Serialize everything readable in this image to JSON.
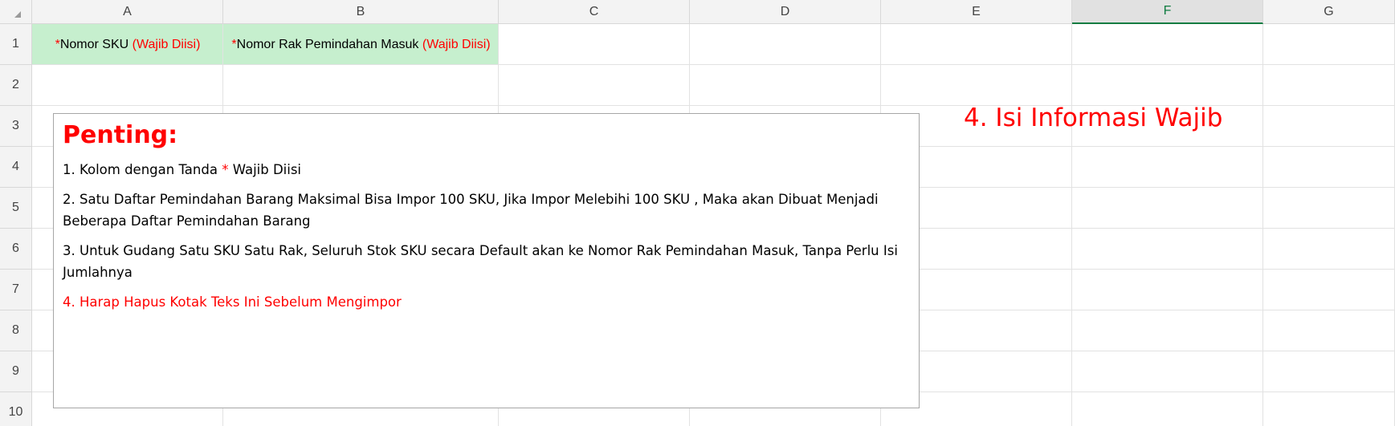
{
  "sheet": {
    "columns": [
      "A",
      "B",
      "C",
      "D",
      "E",
      "F",
      "G"
    ],
    "selected_column": "F",
    "rows": [
      "1",
      "2",
      "3",
      "4",
      "5",
      "6",
      "7",
      "8",
      "9",
      "10"
    ]
  },
  "cells": {
    "A1": {
      "mark": "*",
      "label": "Nomor SKU",
      "suffix": "(Wajib Diisi)"
    },
    "B1": {
      "mark": "*",
      "label": "Nomor Rak Pemindahan Masuk",
      "suffix": "(Wajib Diisi)"
    }
  },
  "textbox": {
    "title": "Penting:",
    "line1_prefix": "1. Kolom dengan Tanda",
    "line1_mark": "*",
    "line1_suffix": "Wajib Diisi",
    "line2": "2. Satu Daftar Pemindahan Barang Maksimal Bisa Impor 100 SKU, Jika Impor Melebihi 100 SKU , Maka akan Dibuat Menjadi Beberapa Daftar Pemindahan Barang",
    "line3": "3. Untuk Gudang Satu SKU Satu Rak, Seluruh Stok SKU secara Default akan ke Nomor Rak Pemindahan Masuk, Tanpa Perlu Isi Jumlahnya",
    "line4": "4. Harap Hapus Kotak Teks Ini Sebelum Mengimpor"
  },
  "annotation": "4. Isi Informasi Wajib",
  "colors": {
    "header_bg": "#f3f3f3",
    "required_fill": "#c6efce",
    "required_text": "#ff0000",
    "selected_accent": "#107c41"
  }
}
